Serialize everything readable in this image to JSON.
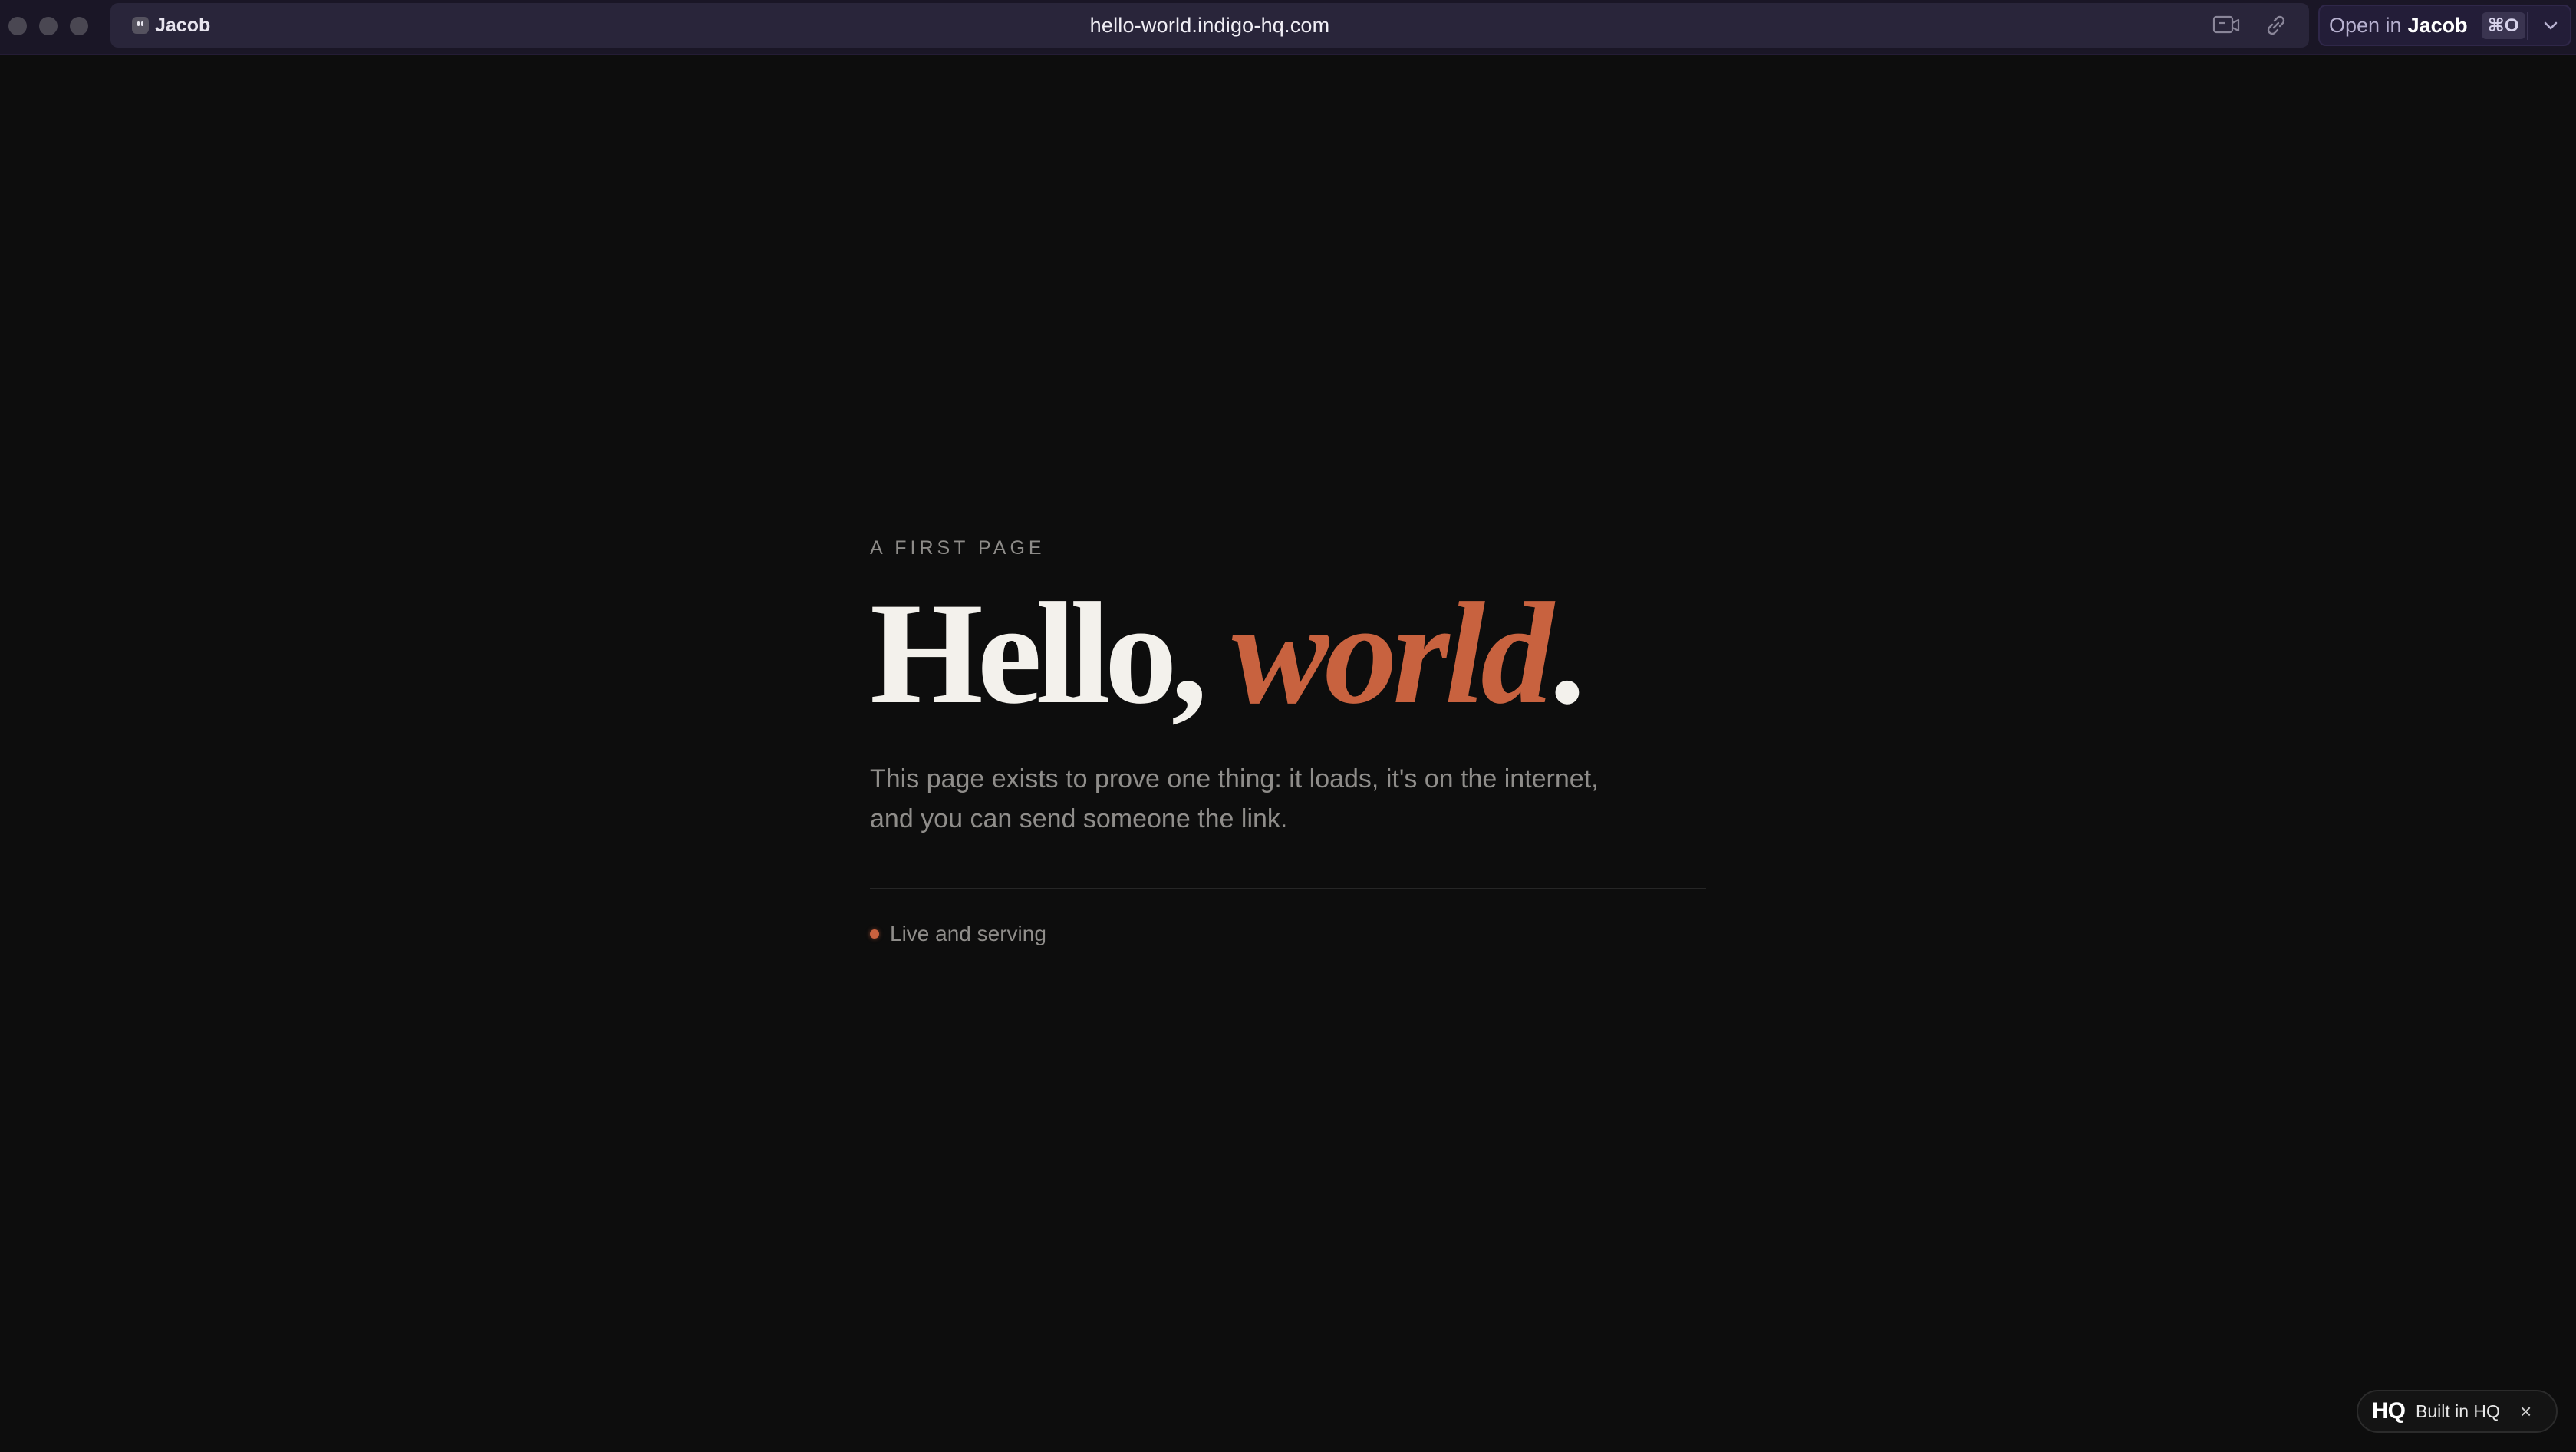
{
  "browser": {
    "profile_name": "Jacob",
    "url": "hello-world.indigo-hq.com",
    "open_in": {
      "prefix": "Open in",
      "target": "Jacob",
      "shortcut": "⌘O"
    },
    "icons": [
      "profile-icon",
      "cast-icon",
      "link-icon",
      "chevron-down-icon"
    ]
  },
  "page": {
    "eyebrow": "A FIRST PAGE",
    "headline_main": "Hello,",
    "headline_accent": "world",
    "headline_end": ".",
    "lede": "This page exists to prove one thing: it loads, it's on the internet, and you can send someone the link.",
    "status": "Live and serving",
    "accent_color": "#c8623f"
  },
  "badge": {
    "logo": "HQ",
    "label": "Built in HQ",
    "close": "×"
  }
}
